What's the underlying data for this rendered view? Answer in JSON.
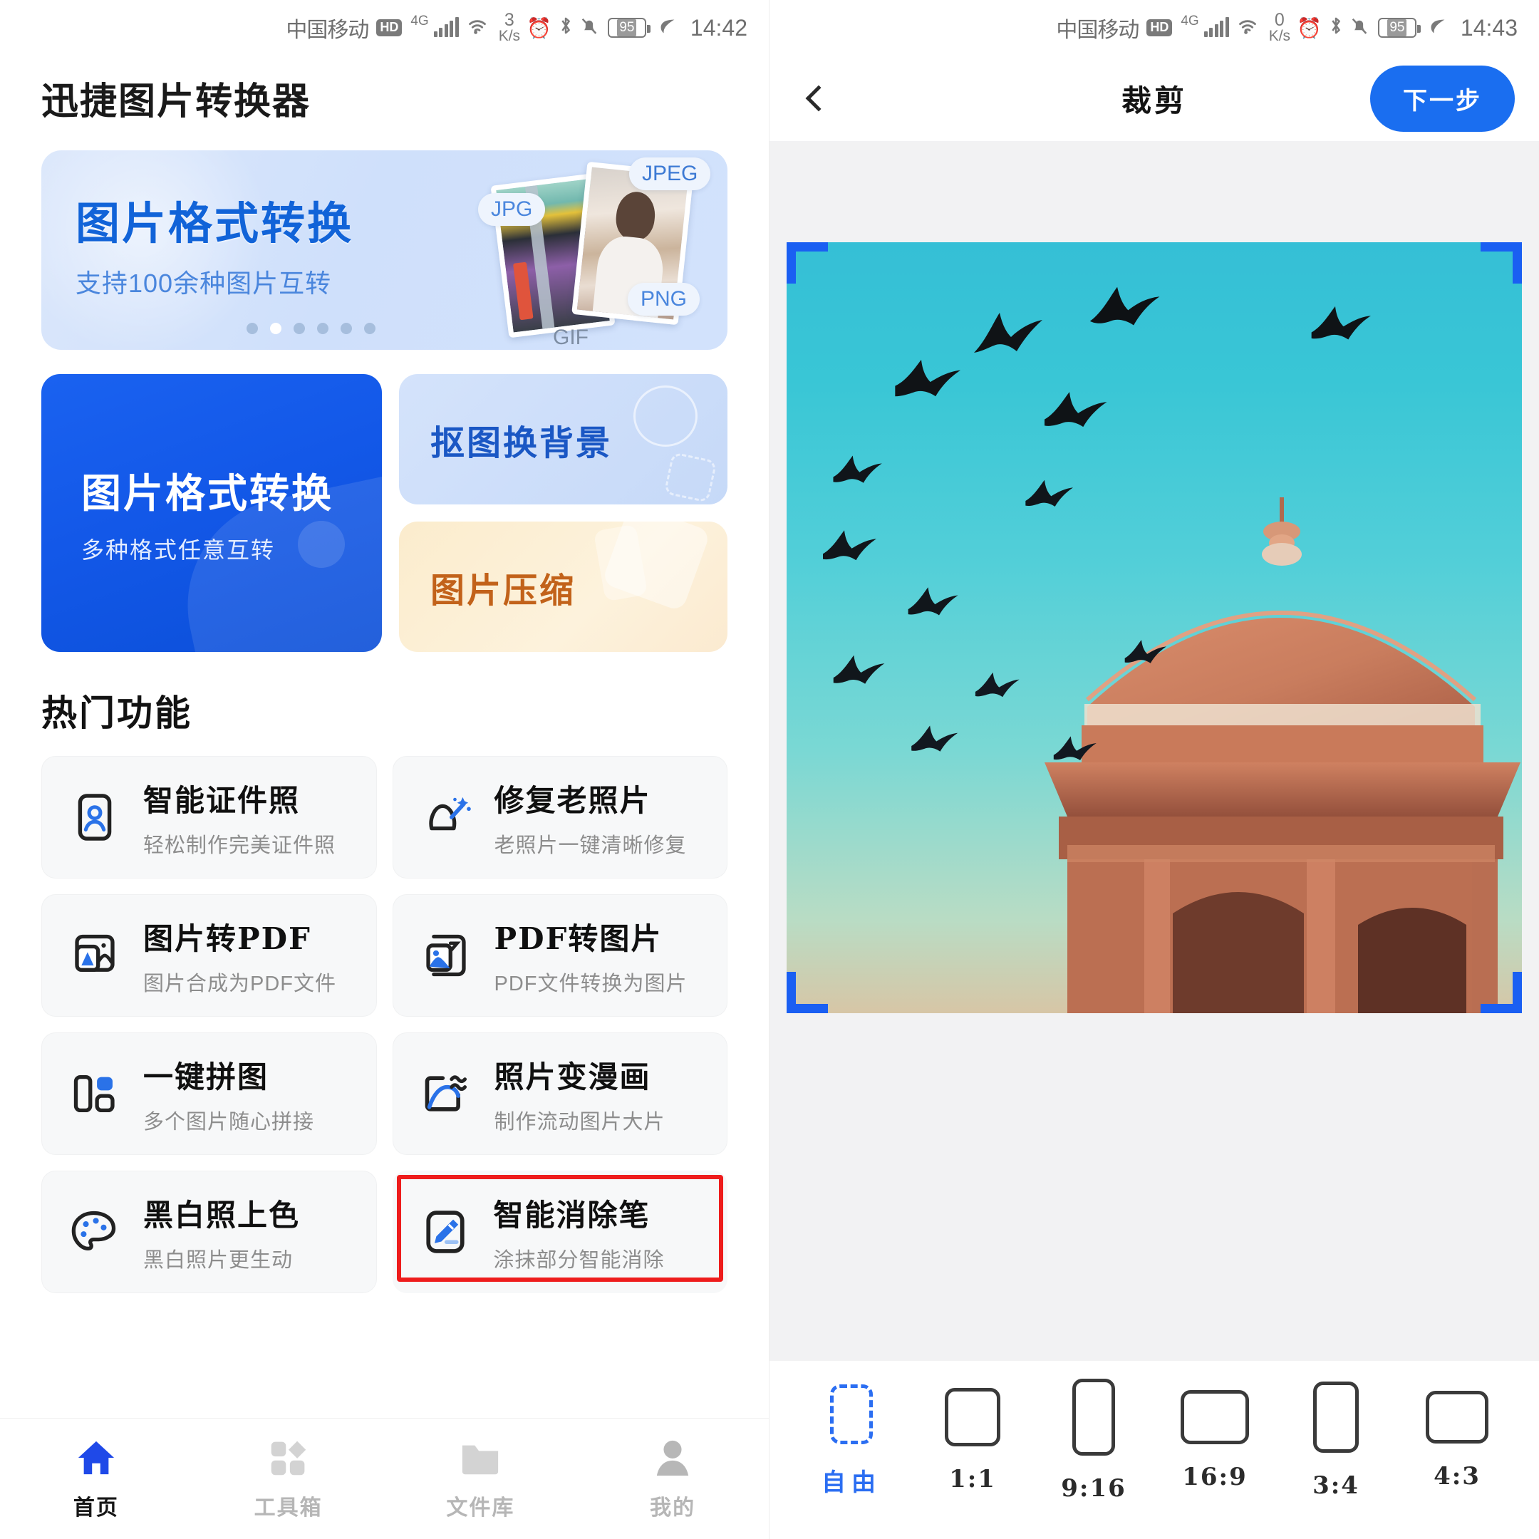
{
  "left": {
    "status": {
      "carrier": "中国移动",
      "hd": "HD",
      "network": "4G",
      "speed_value": "3",
      "speed_unit": "K/s",
      "battery": "95",
      "time": "14:42"
    },
    "app_title": "迅捷图片转换器",
    "banner": {
      "title": "图片格式转换",
      "subtitle": "支持100余种图片互转",
      "badges": [
        "JPG",
        "JPEG",
        "PNG",
        "GIF"
      ],
      "dots_total": 6,
      "dots_active": 2
    },
    "quick": {
      "primary": {
        "title": "图片格式转换",
        "subtitle": "多种格式任意互转"
      },
      "cutout": {
        "title": "抠图换背景"
      },
      "compress": {
        "title": "图片压缩"
      }
    },
    "hot": {
      "heading": "热门功能",
      "items": [
        {
          "name": "智能证件照",
          "desc": "轻松制作完美证件照",
          "icon": "id-photo-icon",
          "highlighted": false
        },
        {
          "name": "修复老照片",
          "desc": "老照片一键清晰修复",
          "icon": "magic-wand-icon",
          "highlighted": false
        },
        {
          "name": "图片转PDF",
          "desc": "图片合成为PDF文件",
          "icon": "image-to-pdf-icon",
          "highlighted": false
        },
        {
          "name": "PDF转图片",
          "desc": "PDF文件转换为图片",
          "icon": "pdf-to-image-icon",
          "highlighted": false
        },
        {
          "name": "一键拼图",
          "desc": "多个图片随心拼接",
          "icon": "collage-icon",
          "highlighted": false
        },
        {
          "name": "照片变漫画",
          "desc": "制作流动图片大片",
          "icon": "live-photo-icon",
          "highlighted": false
        },
        {
          "name": "黑白照上色",
          "desc": "黑白照片更生动",
          "icon": "palette-icon",
          "highlighted": false
        },
        {
          "name": "智能消除笔",
          "desc": "涂抹部分智能消除",
          "icon": "eraser-pen-icon",
          "highlighted": true
        }
      ]
    },
    "tabs": [
      {
        "label": "首页",
        "icon": "home-icon",
        "active": true
      },
      {
        "label": "工具箱",
        "icon": "toolbox-icon",
        "active": false
      },
      {
        "label": "文件库",
        "icon": "folder-icon",
        "active": false
      },
      {
        "label": "我的",
        "icon": "person-icon",
        "active": false
      }
    ]
  },
  "right": {
    "status": {
      "carrier": "中国移动",
      "hd": "HD",
      "network": "4G",
      "speed_value": "0",
      "speed_unit": "K/s",
      "battery": "95",
      "time": "14:43"
    },
    "header": {
      "back_icon": "chevron-left-icon",
      "title": "裁剪",
      "next_label": "下一步"
    },
    "ratios": [
      {
        "label": "自由",
        "w": 60,
        "h": 84,
        "selected": true
      },
      {
        "label": "1:1",
        "w": 78,
        "h": 82,
        "selected": false
      },
      {
        "label": "9:16",
        "w": 60,
        "h": 108,
        "selected": false
      },
      {
        "label": "16:9",
        "w": 96,
        "h": 76,
        "selected": false
      },
      {
        "label": "3:4",
        "w": 64,
        "h": 100,
        "selected": false
      },
      {
        "label": "4:3",
        "w": 88,
        "h": 74,
        "selected": false
      }
    ],
    "colors": {
      "accent": "#1a6ef0",
      "crop_handle": "#1a5ff2",
      "stage_bg": "#f2f2f3"
    }
  },
  "highlight_color": "#ee1c1c"
}
